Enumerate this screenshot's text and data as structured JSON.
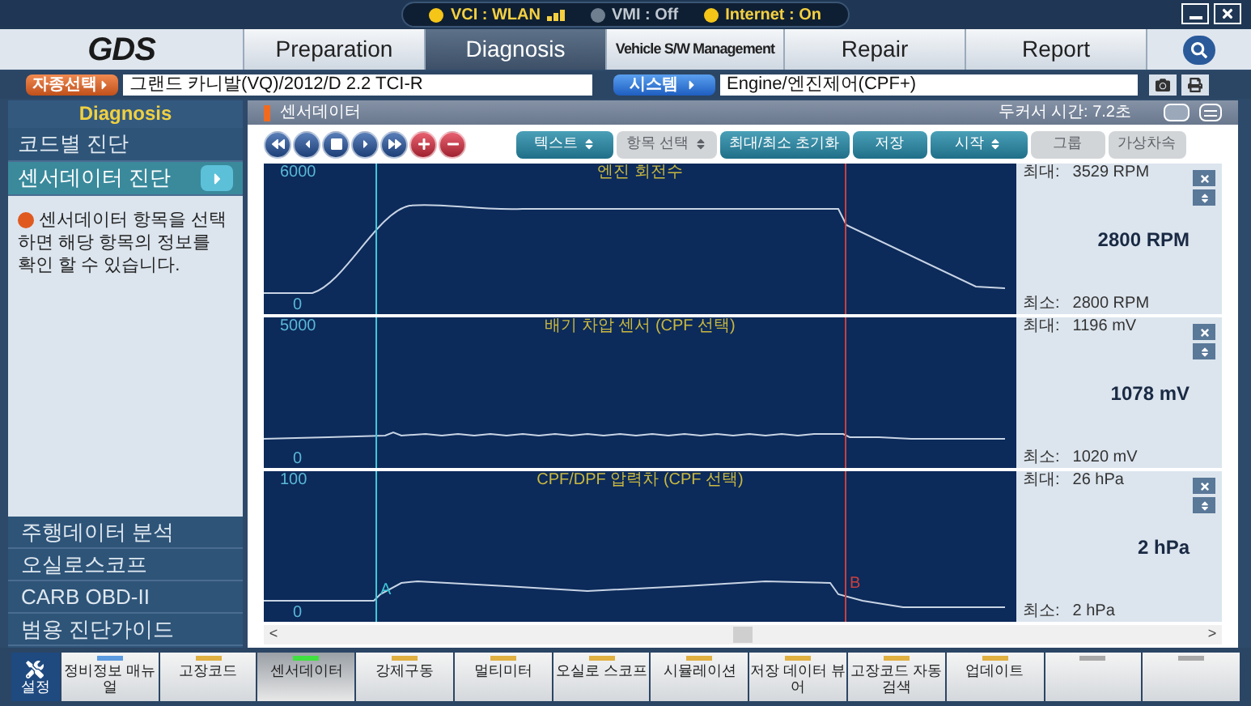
{
  "status": [
    {
      "label": "VCI : WLAN",
      "on": true,
      "signal": true
    },
    {
      "label": "VMI : Off",
      "on": false,
      "signal": false
    },
    {
      "label": "Internet : On",
      "on": true,
      "signal": false
    }
  ],
  "logo": "GDS",
  "tabs": [
    {
      "label": "Preparation",
      "selected": false
    },
    {
      "label": "Diagnosis",
      "selected": true
    },
    {
      "label": "Vehicle S/W Management",
      "selected": false
    },
    {
      "label": "Repair",
      "selected": false
    },
    {
      "label": "Report",
      "selected": false
    }
  ],
  "vehicle": {
    "button": "자종선택",
    "value": "그랜드 카니발(VQ)/2012/D 2.2 TCI-R"
  },
  "system": {
    "button": "시스템",
    "value": "Engine/엔진제어(CPF+)"
  },
  "sidebar": {
    "title": "Diagnosis",
    "items": [
      {
        "label": "코드별 진단",
        "selected": false
      },
      {
        "label": "센서데이터 진단",
        "selected": true
      }
    ],
    "info": "센서데이터 항목을 선택하면 해당 항목의 정보를 확인 할 수 있습니다.",
    "bottom_items": [
      {
        "label": "주행데이터 분석"
      },
      {
        "label": "오실로스코프"
      },
      {
        "label": "CARB OBD-II"
      },
      {
        "label": "범용 진단가이드"
      }
    ]
  },
  "panel": {
    "title": "센서데이터",
    "cursor_time": "두커서 시간: 7.2초"
  },
  "toolbar": [
    {
      "label": "텍스트",
      "menu": true,
      "disabled": false
    },
    {
      "label": "항목 선택",
      "menu": true,
      "disabled": true
    },
    {
      "label": "최대/최소 초기화",
      "menu": false,
      "disabled": false
    },
    {
      "label": "저장",
      "menu": false,
      "disabled": false
    },
    {
      "label": "시작",
      "menu": true,
      "disabled": false
    },
    {
      "label": "그룹",
      "menu": false,
      "disabled": true
    },
    {
      "label": "가상차속",
      "menu": false,
      "disabled": true
    }
  ],
  "cursors": [
    {
      "color": "#3cc8d8"
    },
    {
      "color": "#c84040"
    }
  ],
  "graphs": [
    {
      "title": "엔진 회전수",
      "ymax": "6000",
      "ymin": "0",
      "max_label": "최대:",
      "max_value": "3529 RPM",
      "value": "2800 RPM",
      "min_label": "최소:",
      "min_value": "2800 RPM"
    },
    {
      "title": "배기 차압 센서 (CPF 선택)",
      "ymax": "5000",
      "ymin": "0",
      "max_label": "최대:",
      "max_value": "1196 mV",
      "value": "1078 mV",
      "min_label": "최소:",
      "min_value": "1020 mV"
    },
    {
      "title": "CPF/DPF 압력차 (CPF 선택)",
      "ymax": "100",
      "ymin": "0",
      "max_label": "최대:",
      "max_value": "26 hPa",
      "value": "2 hPa",
      "min_label": "최소:",
      "min_value": "2 hPa",
      "cursor_labels": [
        "A",
        "B"
      ]
    }
  ],
  "scrollbar": {
    "left": "<",
    "right": ">"
  },
  "settings": {
    "label": "설정"
  },
  "taskbar": [
    {
      "label": "정비정보 매뉴얼",
      "color": "#5b9be0",
      "selected": false
    },
    {
      "label": "고장코드",
      "color": "#e0b040",
      "selected": false
    },
    {
      "label": "센서데이터",
      "color": "#40e040",
      "selected": true
    },
    {
      "label": "강제구동",
      "color": "#e0b040",
      "selected": false
    },
    {
      "label": "멀티미터",
      "color": "#e0b040",
      "selected": false
    },
    {
      "label": "오실로 스코프",
      "color": "#e0b040",
      "selected": false
    },
    {
      "label": "시뮬레이션",
      "color": "#e0b040",
      "selected": false
    },
    {
      "label": "저장 데이터 뷰어",
      "color": "#e0b040",
      "selected": false
    },
    {
      "label": "고장코드 자동검색",
      "color": "#e0b040",
      "selected": false
    },
    {
      "label": "업데이트",
      "color": "#e0b040",
      "selected": false
    },
    {
      "color": "#a8a8a8",
      "selected": false
    },
    {
      "color": "#a8a8a8",
      "selected": false
    }
  ]
}
